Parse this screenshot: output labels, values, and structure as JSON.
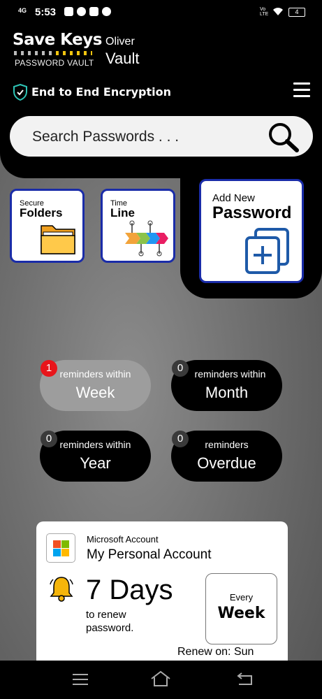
{
  "status_bar": {
    "signal": "4G",
    "time": "5:53",
    "network": "Vo LTE",
    "battery": "4"
  },
  "header": {
    "app_name": "Save Keys",
    "app_subtitle": "PASSWORD VAULT",
    "user_name": "Oliver",
    "vault_label": "Vault",
    "encryption_text": "End to End Encryption"
  },
  "search": {
    "placeholder": "Search Passwords . . ."
  },
  "tiles": {
    "folders": {
      "small": "Secure",
      "big": "Folders"
    },
    "timeline": {
      "small": "Time",
      "big": "Line"
    },
    "add_new": {
      "small": "Add New",
      "big": "Password"
    }
  },
  "reminders": [
    {
      "count": "1",
      "label": "reminders within",
      "period": "Week",
      "active": true
    },
    {
      "count": "0",
      "label": "reminders within",
      "period": "Month",
      "active": false
    },
    {
      "count": "0",
      "label": "reminders within",
      "period": "Year",
      "active": false
    },
    {
      "count": "0",
      "label": "reminders",
      "period": "Overdue",
      "active": false
    }
  ],
  "card": {
    "account_type": "Microsoft Account",
    "account_name": "My Personal Account",
    "days": "7 Days",
    "renew_text_1": "to renew",
    "renew_text_2": "password.",
    "every_label": "Every",
    "every_value": "Week",
    "renew_on": "Renew on: Sun"
  },
  "colors": {
    "accent_blue": "#1a2ca8",
    "badge_red": "#e8151b",
    "bell_yellow": "#f5b50a"
  }
}
